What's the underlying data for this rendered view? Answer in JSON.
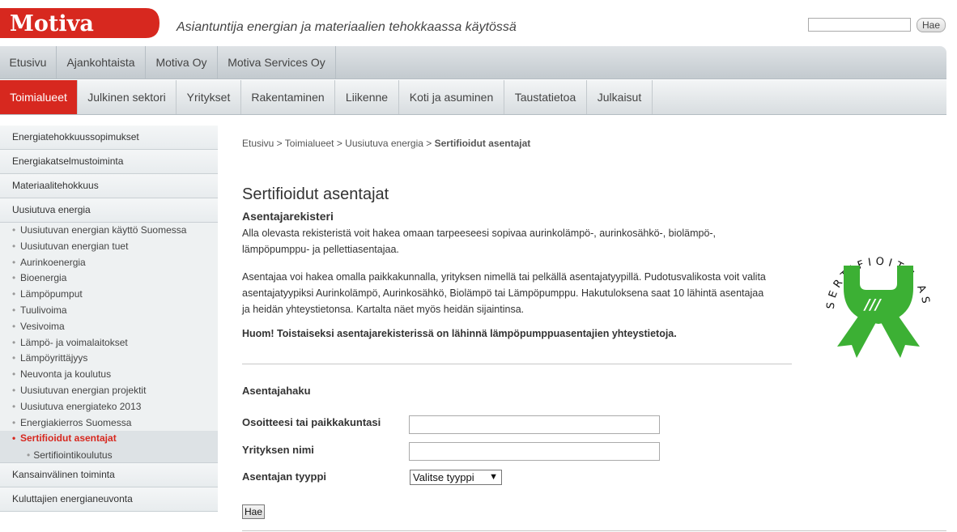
{
  "header": {
    "brand": "Motiva",
    "tagline": "Asiantuntija energian ja materiaalien tehokkaassa käytössä",
    "search_button": "Hae"
  },
  "nav_primary": [
    {
      "label": "Etusivu"
    },
    {
      "label": "Ajankohtaista"
    },
    {
      "label": "Motiva Oy"
    },
    {
      "label": "Motiva Services Oy"
    }
  ],
  "nav_secondary": [
    {
      "label": "Toimialueet",
      "active": true
    },
    {
      "label": "Julkinen sektori"
    },
    {
      "label": "Yritykset"
    },
    {
      "label": "Rakentaminen"
    },
    {
      "label": "Liikenne"
    },
    {
      "label": "Koti ja asuminen"
    },
    {
      "label": "Taustatietoa"
    },
    {
      "label": "Julkaisut"
    }
  ],
  "sidebar": {
    "top_items": [
      {
        "label": "Energiatehokkuussopimukset"
      },
      {
        "label": "Energiakatselmustoiminta"
      },
      {
        "label": "Materiaalitehokkuus"
      },
      {
        "label": "Uusiutuva energia"
      }
    ],
    "sub_items": [
      {
        "label": "Uusiutuvan energian käyttö Suomessa"
      },
      {
        "label": "Uusiutuvan energian tuet"
      },
      {
        "label": "Aurinkoenergia"
      },
      {
        "label": "Bioenergia"
      },
      {
        "label": "Lämpöpumput"
      },
      {
        "label": "Tuulivoima"
      },
      {
        "label": "Vesivoima"
      },
      {
        "label": "Lämpö- ja voimalaitokset"
      },
      {
        "label": "Lämpöyrittäjyys"
      },
      {
        "label": "Neuvonta ja koulutus"
      },
      {
        "label": "Uusiutuvan energian projektit"
      },
      {
        "label": "Uusiutuva energiateko 2013"
      },
      {
        "label": "Energiakierros Suomessa"
      },
      {
        "label": "Sertifioidut asentajat",
        "active": true
      }
    ],
    "subsub_item": "Sertifiointikoulutus",
    "bottom_items": [
      {
        "label": "Kansainvälinen toiminta"
      },
      {
        "label": "Kuluttajien energianeuvonta"
      }
    ]
  },
  "breadcrumb": {
    "path": "Etusivu > Toimialueet > Uusiutuva energia > ",
    "current": "Sertifioidut asentajat"
  },
  "main": {
    "title": "Sertifioidut asentajat",
    "subtitle": "Asentajarekisteri",
    "para1_line1": "Alla olevasta rekisteristä voit hakea omaan tarpeeseesi sopivaa aurinkolämpö-, aurinkosähkö-, biolämpö-,",
    "para1_line2": "lämpöpumppu- ja pellettiasentajaa.",
    "para2_line1": "Asentajaa voi hakea omalla paikkakunnalla, yrityksen nimellä tai pelkällä asentajatyypillä. Pudotusvalikosta voit valita",
    "para2_line2": "asentajatyypiksi Aurinkolämpö, Aurinkosähkö, Biolämpö tai Lämpöpumppu. Hakutuloksena saat 10 lähintä asentajaa",
    "para2_line3": "ja heidän yhteystietonsa. Kartalta näet myös heidän sijaintinsa.",
    "notice": "Huom! Toistaiseksi asentajarekisterissä on lähinnä lämpöpumppuasentajien yhteystietoja.",
    "badge_text": "SERTIFIOITU ASENTAJA"
  },
  "form": {
    "heading": "Asentajahaku",
    "address_label": "Osoitteesi tai paikkakuntasi",
    "company_label": "Yrityksen nimi",
    "type_label": "Asentajan tyyppi",
    "type_selected": "Valitse tyyppi",
    "submit": "Hae"
  },
  "colors": {
    "brand_red": "#d7281f",
    "badge_green": "#3cb034"
  }
}
